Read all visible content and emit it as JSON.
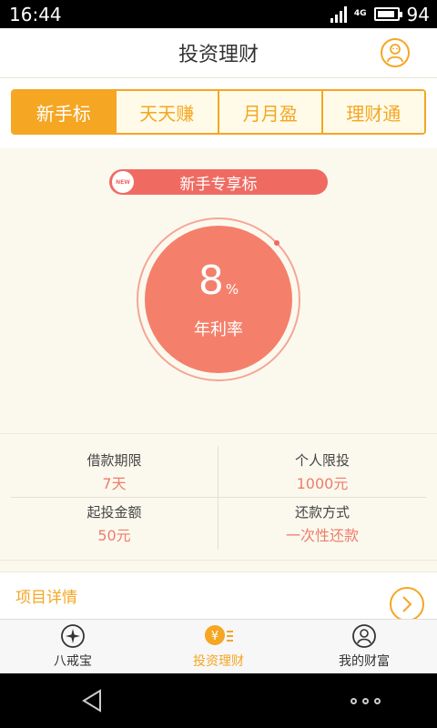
{
  "status": {
    "time": "16:44",
    "network": "4G",
    "battery": "94"
  },
  "header": {
    "title": "投资理财",
    "user_icon": "user-icon"
  },
  "tabs": [
    {
      "label": "新手标",
      "active": true
    },
    {
      "label": "天天赚",
      "active": false
    },
    {
      "label": "月月盈",
      "active": false
    },
    {
      "label": "理财通",
      "active": false
    }
  ],
  "hero": {
    "badge_new": "NEW",
    "badge_label": "新手专享标",
    "rate_value": "8",
    "rate_unit": "%",
    "rate_label": "年利率"
  },
  "info": [
    {
      "label": "借款期限",
      "value": "7天"
    },
    {
      "label": "个人限投",
      "value": "1000元"
    },
    {
      "label": "起投金额",
      "value": "50元"
    },
    {
      "label": "还款方式",
      "value": "一次性还款"
    }
  ],
  "detail": {
    "label": "项目详情"
  },
  "nav": [
    {
      "label": "八戒宝",
      "icon": "compass-icon",
      "active": false
    },
    {
      "label": "投资理财",
      "icon": "yen-coin-icon",
      "active": true
    },
    {
      "label": "我的财富",
      "icon": "user-circle-icon",
      "active": false
    }
  ],
  "colors": {
    "accent": "#f5a623",
    "rate": "#f4806b",
    "badge": "#ef6b62",
    "background": "#fbf9ee"
  }
}
